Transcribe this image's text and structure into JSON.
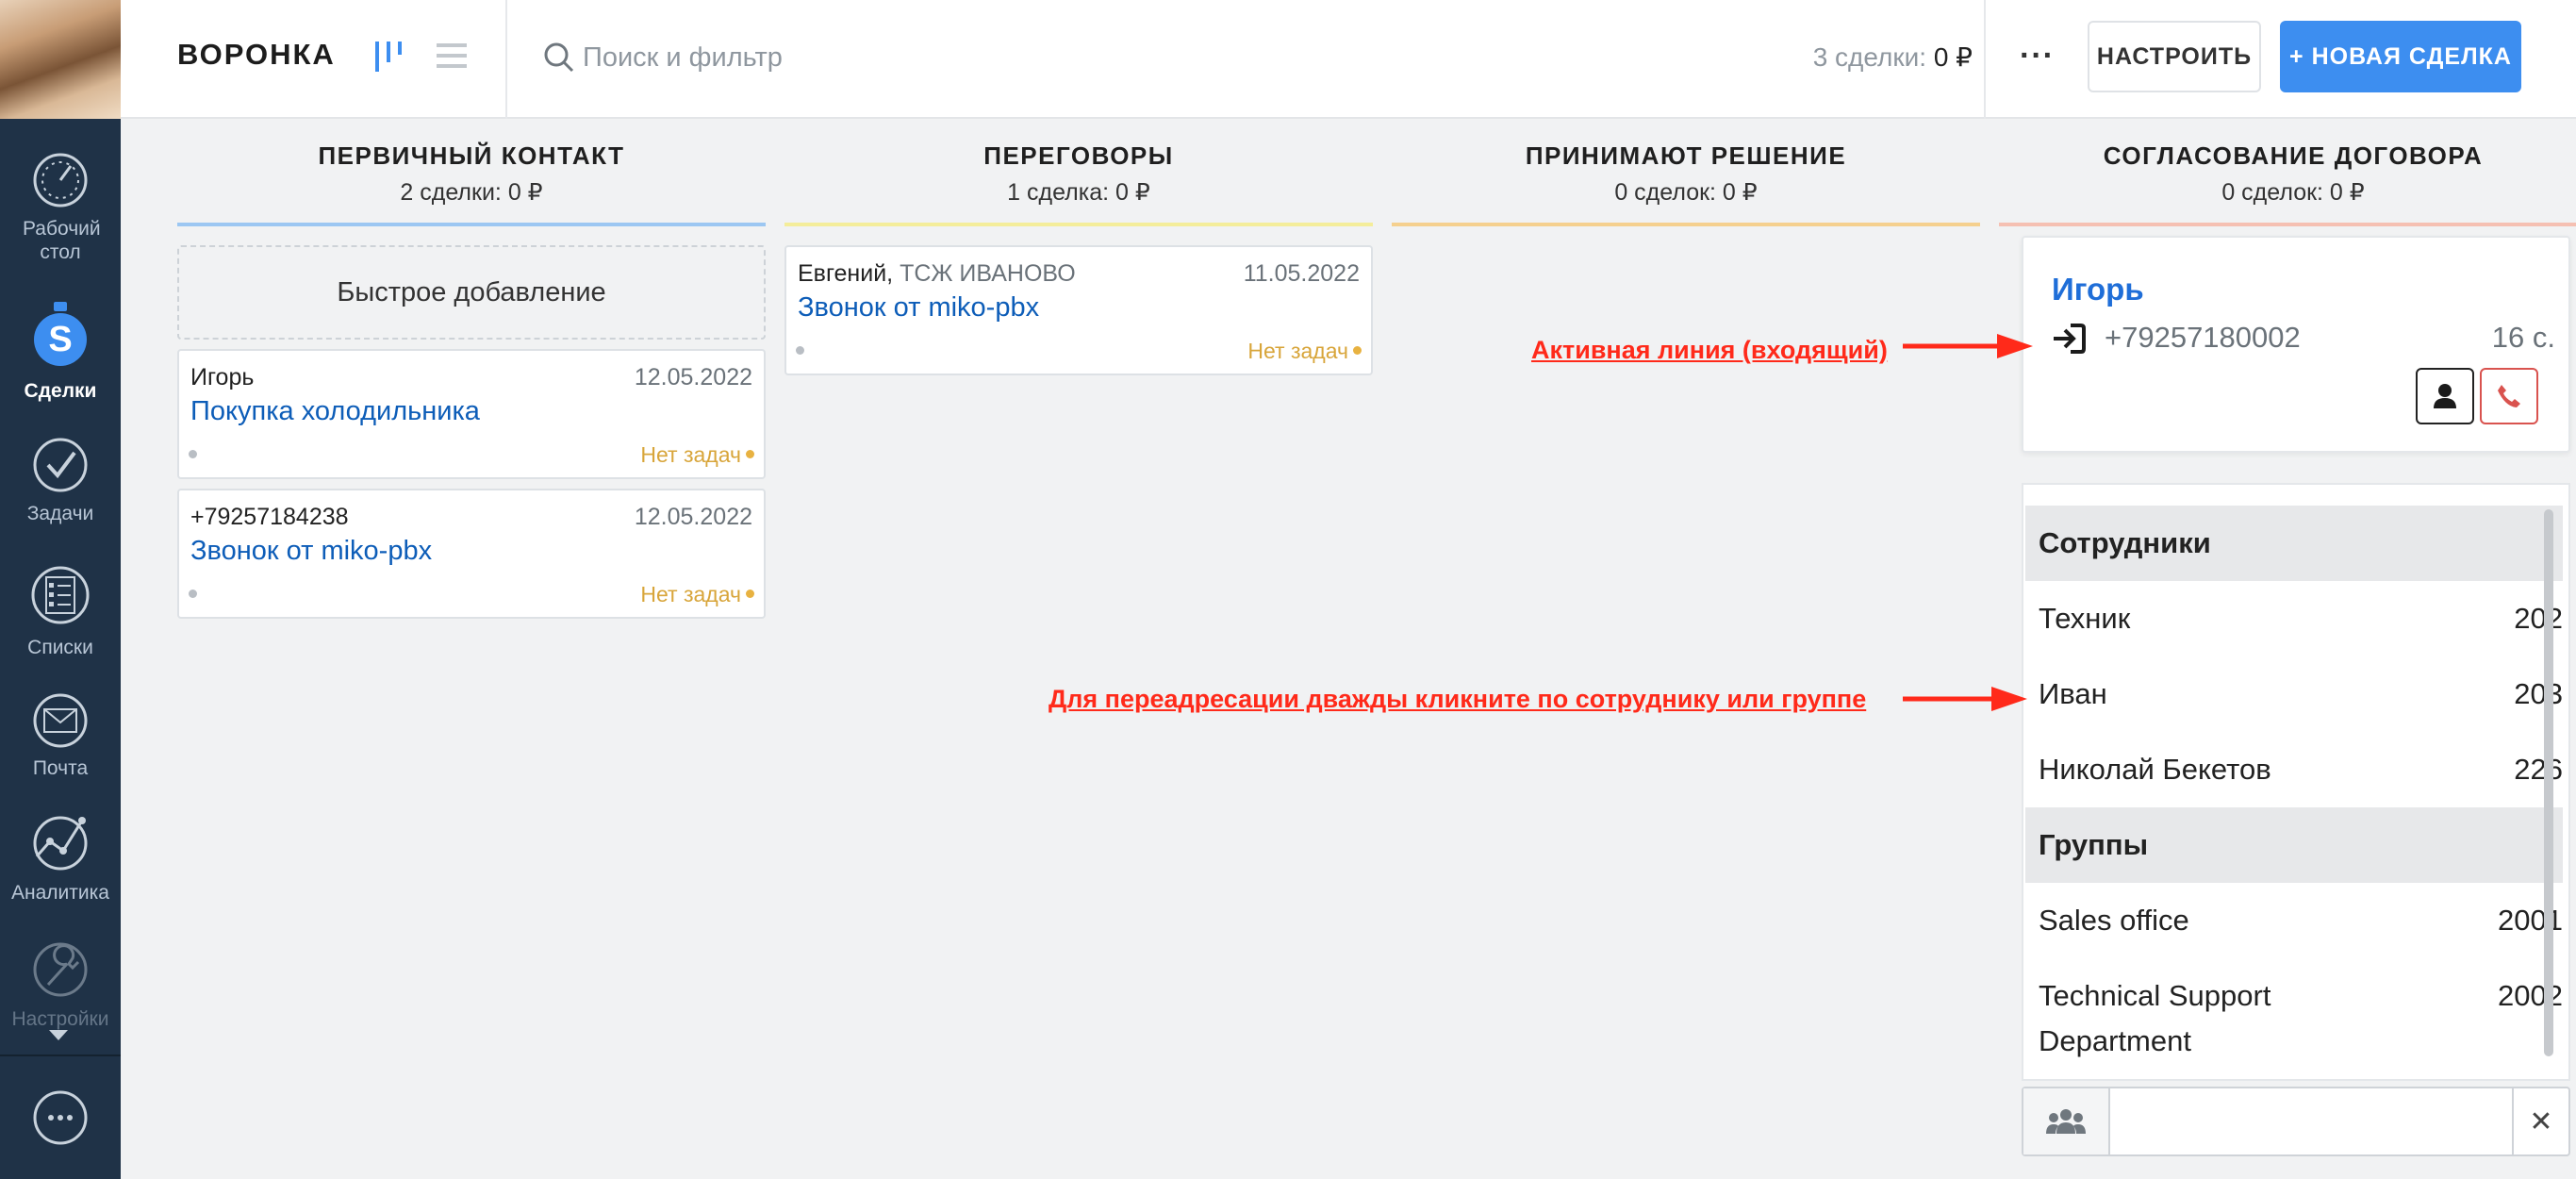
{
  "sidebar": {
    "items": [
      {
        "label": "Рабочий стол",
        "icon": "dashboard-icon"
      },
      {
        "label": "Сделки",
        "icon": "deals-icon",
        "active": true
      },
      {
        "label": "Задачи",
        "icon": "tasks-icon"
      },
      {
        "label": "Списки",
        "icon": "lists-icon"
      },
      {
        "label": "Почта",
        "icon": "mail-icon"
      },
      {
        "label": "Аналитика",
        "icon": "analytics-icon"
      },
      {
        "label": "Настройки",
        "icon": "settings-icon"
      }
    ],
    "chat_icon": "chat-icon"
  },
  "topbar": {
    "title": "ВОРОНКА",
    "search_placeholder": "Поиск и фильтр",
    "summary_label": "3 сделки:",
    "summary_value": "0 ₽",
    "more_label": "···",
    "setup_label": "НАСТРОИТЬ",
    "new_deal_label": "+ НОВАЯ СДЕЛКА"
  },
  "columns": [
    {
      "title": "ПЕРВИЧНЫЙ КОНТАКТ",
      "sub": "2 сделки: 0 ₽",
      "color": "#9cc7f2"
    },
    {
      "title": "ПЕРЕГОВОРЫ",
      "sub": "1 сделка: 0 ₽",
      "color": "#f4ed9a"
    },
    {
      "title": "ПРИНИМАЮТ РЕШЕНИЕ",
      "sub": "0 сделок: 0 ₽",
      "color": "#f5d08e"
    },
    {
      "title": "СОГЛАСОВАНИЕ ДОГОВОРА",
      "sub": "0 сделок: 0 ₽",
      "color": "#f5c0b2"
    }
  ],
  "quick_add": "Быстрое добавление",
  "cards": [
    {
      "who": "Игорь",
      "org": "",
      "date": "12.05.2022",
      "deal": "Покупка холодильника",
      "status": "Нет задач"
    },
    {
      "who": "+79257184238",
      "org": "",
      "date": "12.05.2022",
      "deal": "Звонок от miko-pbx",
      "status": "Нет задач"
    },
    {
      "who": "Евгений,",
      "org": "ТСЖ ИВАНОВО",
      "date": "11.05.2022",
      "deal": "Звонок от miko-pbx",
      "status": "Нет задач"
    }
  ],
  "call": {
    "name": "Игорь",
    "number": "+79257180002",
    "duration": "16 с."
  },
  "transfer": {
    "employees_header": "Сотрудники",
    "employees": [
      {
        "name": "Техник",
        "ext": "202"
      },
      {
        "name": "Иван",
        "ext": "203"
      },
      {
        "name": "Николай Бекетов",
        "ext": "226"
      }
    ],
    "groups_header": "Группы",
    "groups": [
      {
        "name": "Sales office",
        "ext": "2001"
      },
      {
        "name": "Technical Support Department",
        "ext": "2002"
      }
    ],
    "close_label": "✕"
  },
  "annotations": {
    "active_line": "Активная линия (входящий)",
    "transfer_hint": "Для переадресации дважды кликните по сотруднику или группе",
    "color": "#ff2a1a"
  }
}
